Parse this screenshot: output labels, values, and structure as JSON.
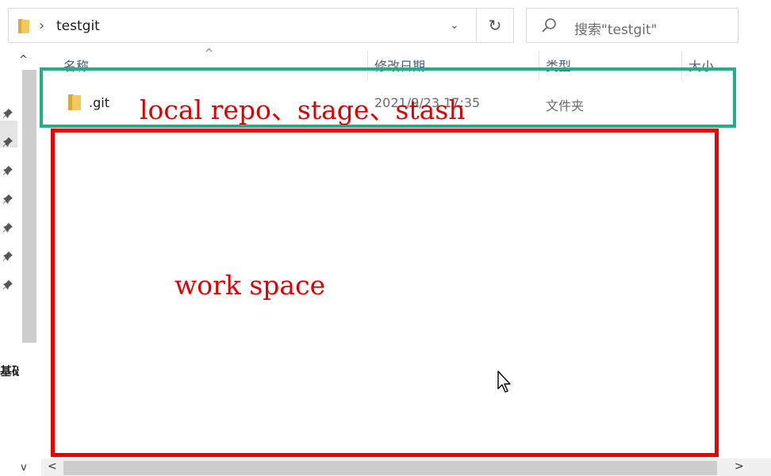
{
  "address": {
    "path": "testgit",
    "separator": "›",
    "dropdown": "⌄",
    "refresh": "↻"
  },
  "search": {
    "placeholder": "搜索\"testgit\""
  },
  "columns": {
    "name": "名称",
    "date": "修改日期",
    "type": "类型",
    "size": "大小"
  },
  "sort_indicator": "^",
  "files": [
    {
      "name": ".git",
      "modified": "2021/9/23 17:35",
      "type": "文件夹"
    }
  ],
  "nav": {
    "label": "基础",
    "scroll_up": "^",
    "scroll_down": "v"
  },
  "hscroll": {
    "left": "<",
    "right": ">"
  },
  "annotations": {
    "repo": "local repo、stage、stash",
    "workspace": "work space"
  },
  "colors": {
    "green_box": "#1fb08a",
    "red_box": "#ee0000",
    "annotation_text": "#e00000",
    "folder": "#e8b94a"
  }
}
